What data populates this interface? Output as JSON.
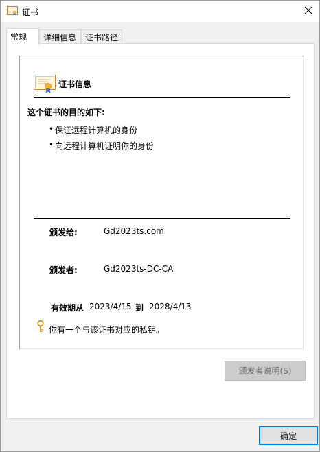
{
  "window": {
    "title": "证书"
  },
  "tabs": [
    {
      "label": "常规"
    },
    {
      "label": "详细信息"
    },
    {
      "label": "证书路径"
    }
  ],
  "cert_info": {
    "heading": "证书信息",
    "purpose_title": "这个证书的目的如下:",
    "purposes": [
      "保证远程计算机的身份",
      "向远程计算机证明你的身份"
    ],
    "issued_to_label": "颁发给:",
    "issued_to_value": "Gd2023ts.com",
    "issued_by_label": "颁发者:",
    "issued_by_value": "Gd2023ts-DC-CA",
    "valid_from_label": "有效期从",
    "valid_from_value": "2023/4/15",
    "valid_to_label": "到",
    "valid_to_value": "2028/4/13",
    "private_key_note": "你有一个与该证书对应的私钥。"
  },
  "buttons": {
    "issuer_statement": "颁发者说明(S)",
    "ok": "确定"
  },
  "colors": {
    "accent": "#0078d7",
    "key_icon": "#c89a1b"
  },
  "icons": {
    "title": "certificate-icon",
    "close": "close-icon",
    "cert": "certificate-icon",
    "key": "key-icon"
  }
}
